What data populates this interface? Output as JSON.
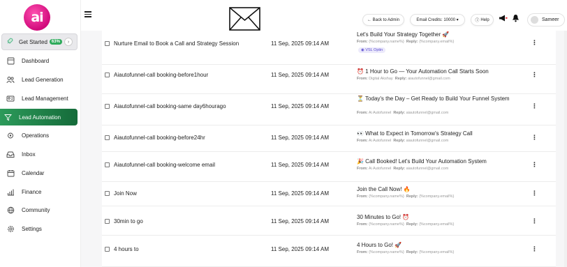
{
  "sidebar": {
    "logo_text": "ai",
    "get_started": {
      "label": "Get Started",
      "badge": "63%"
    },
    "items": [
      {
        "label": "Dashboard",
        "icon": "dashboard-icon"
      },
      {
        "label": "Lead Generation",
        "icon": "people-icon"
      },
      {
        "label": "Lead Management",
        "icon": "lead-management-icon"
      },
      {
        "label": "Lead Automation",
        "icon": "funnel-icon",
        "active": true
      },
      {
        "label": "Operations",
        "icon": "operations-icon"
      },
      {
        "label": "Inbox",
        "icon": "inbox-icon"
      },
      {
        "label": "Calendar",
        "icon": "calendar-icon"
      },
      {
        "label": "Finance",
        "icon": "finance-icon"
      },
      {
        "label": "Community",
        "icon": "globe-icon"
      },
      {
        "label": "Settings",
        "icon": "gear-icon"
      }
    ]
  },
  "topbar": {
    "back_label": "← Back to Admin",
    "credits_label": "Email Credits: 10000 ▾",
    "help_label": "Help",
    "user_name": "Sameer"
  },
  "rows": [
    {
      "name": "Nurture Email to Book a Call and Strategy Session",
      "date": "11 Sep, 2025 09:14 AM",
      "subject": "Let's Build Your Strategy Together 🚀",
      "from": "{%company.name%}",
      "reply": "{%company.email%}",
      "tag": "VSL Optin"
    },
    {
      "name": "Aiautofunnel-call booking-before1hour",
      "date": "11 Sep, 2025 09:14 AM",
      "subject": "⏰ 1 Hour to Go — Your Automation Call Starts Soon",
      "from": "Digital Akshay",
      "reply": "aiautofunnel@gmail.com"
    },
    {
      "name": "Aiautofunnel-call booking-same day6hourago",
      "date": "11 Sep, 2025 09:14 AM",
      "subject": "⏳ Today's the Day – Get Ready to Build Your Funnel System",
      "from": "Ai Autofunnel",
      "reply": "aiautofunnel@gmail.com"
    },
    {
      "name": "Aiautofunnel-call booking-before24hr",
      "date": "11 Sep, 2025 09:14 AM",
      "subject": "👀 What to Expect in Tomorrow's Strategy Call",
      "from": "Ai Autofunnel",
      "reply": "aiautofunnel@gmail.com"
    },
    {
      "name": "Aiautofunnel-call booking-welcome email",
      "date": "11 Sep, 2025 09:14 AM",
      "subject": "🎉 Call Booked! Let's Build Your Automation System",
      "from": "Ai Autofunnel",
      "reply": "aiautofunnel@gmail.com"
    },
    {
      "name": "Join Now",
      "date": "11 Sep, 2025 09:14 AM",
      "subject": "Join the Call Now! 🔥",
      "from": "{%company.name%}",
      "reply": "{%company.email%}"
    },
    {
      "name": "30min to go",
      "date": "11 Sep, 2025 09:14 AM",
      "subject": "30 Minutes to Go! ⏰",
      "from": "{%company.name%}",
      "reply": "{%company.email%}"
    },
    {
      "name": "4 hours to",
      "date": "11 Sep, 2025 09:14 AM",
      "subject": "4 Hours to Go! 🚀",
      "from": "{%company.name%}",
      "reply": "{%company.email%}"
    }
  ],
  "labels": {
    "from": "From:",
    "reply": "Reply:"
  }
}
